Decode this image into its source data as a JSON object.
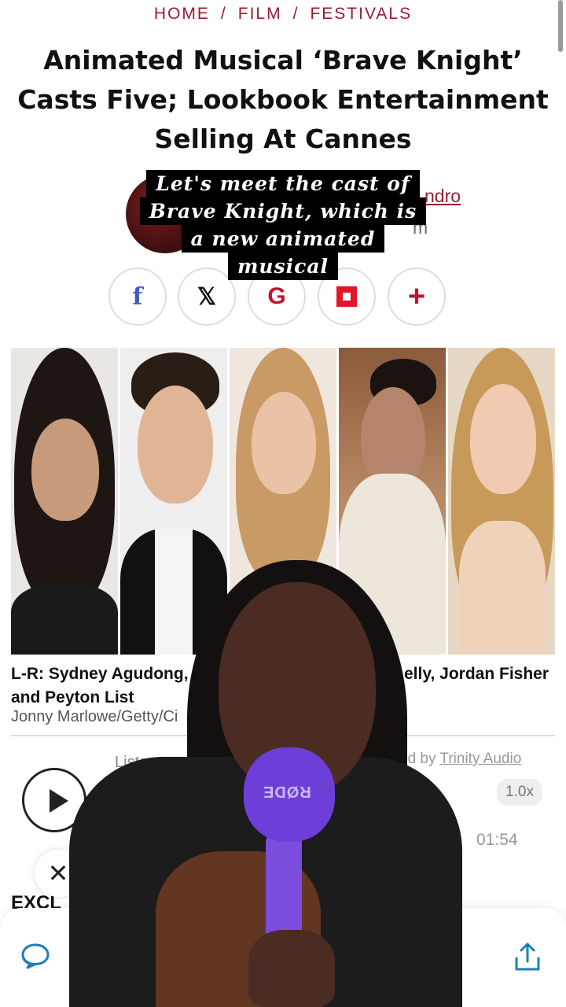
{
  "breadcrumb": {
    "items": [
      "HOME",
      "FILM",
      "FESTIVALS"
    ],
    "separator": "/"
  },
  "headline": "Animated Musical ‘Brave Knight’ Casts Five; Lookbook Entertainment Selling At Cannes",
  "author": {
    "name_fragment": "ndro",
    "sub_fragment": "m"
  },
  "video_caption": [
    "Let's meet the cast of",
    "Brave Knight, which is",
    "a new animated",
    "musical"
  ],
  "share": {
    "facebook": "f",
    "x": "𝕏",
    "google": "G",
    "plus": "+"
  },
  "photo": {
    "caption_left": "L-R: Sydney Agudong,",
    "caption_right": "elly, Jordan Fisher",
    "caption_line2": "and Peyton List",
    "credit": "Jonny Marlowe/Getty/Ci"
  },
  "audio": {
    "listen_label": "Liste",
    "powered_prefix": "ed by",
    "powered_brand": "Trinity Audio",
    "speed": "1.0x",
    "duration": "01:54"
  },
  "close_symbol": "✕",
  "article_start": "EXCL",
  "mic_brand": "RØDE",
  "colors": {
    "accent": "#9b1b30",
    "facebook": "#3b5bc6",
    "flipboard": "#e3152a",
    "mic": "#6e3fd8"
  }
}
